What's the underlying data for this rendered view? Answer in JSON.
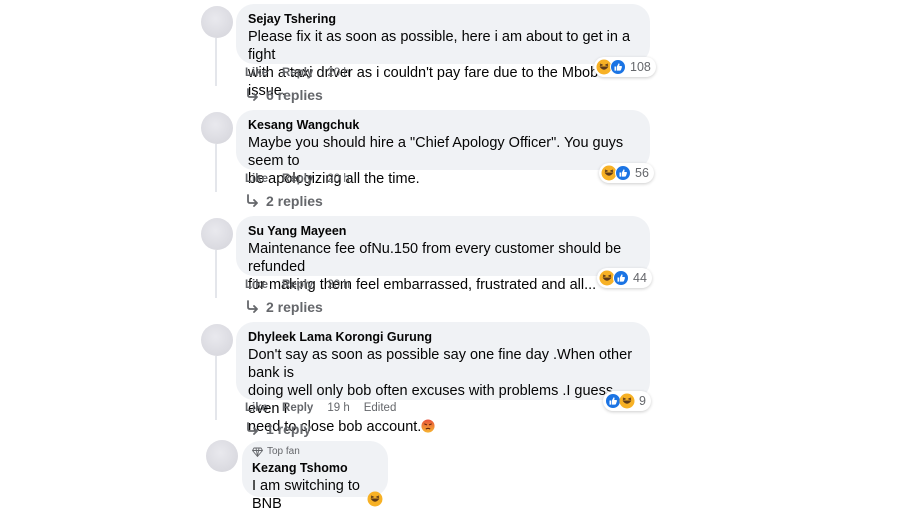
{
  "actions": {
    "like": "Like",
    "reply": "Reply"
  },
  "comments": [
    {
      "author": "Sejay Tshering",
      "lines": [
        "Please fix it as soon as possible, here i am about to get in a fight",
        "with a taxi driver as i couldn't pay fare due to the Mbob issue."
      ],
      "time": "20 h",
      "reactions": [
        "haha",
        "like"
      ],
      "reaction_count": "108",
      "replies": "6 replies"
    },
    {
      "author": "Kesang Wangchuk",
      "lines": [
        "Maybe you should hire a \"Chief Apology Officer\". You guys seem to",
        "be apologizing all the time."
      ],
      "time": "20 h",
      "reactions": [
        "haha",
        "like"
      ],
      "reaction_count": "56",
      "replies": "2 replies"
    },
    {
      "author": "Su Yang Mayeen",
      "lines": [
        "Maintenance fee ofNu.150 from every customer should be refunded",
        "for making them feel embarrassed, frustrated and all..."
      ],
      "time": "20 h",
      "reactions": [
        "haha",
        "like"
      ],
      "reaction_count": "44",
      "replies": "2 replies"
    },
    {
      "author": "Dhyleek Lama Korongi Gurung",
      "lines": [
        "Don't say as soon as possible say one fine day .When other bank is",
        "doing well only bob often excuses with problems .I guess even I",
        "need to close bob account."
      ],
      "time": "19 h",
      "edited": "Edited",
      "reactions": [
        "like",
        "haha"
      ],
      "reaction_count": "9",
      "replies": "1 reply",
      "inline_emoji": "angry-face"
    },
    {
      "badge": "Top fan",
      "author": "Kezang Tshomo",
      "lines": [
        "I am switching to BNB"
      ],
      "reactions": [
        "haha"
      ]
    }
  ]
}
